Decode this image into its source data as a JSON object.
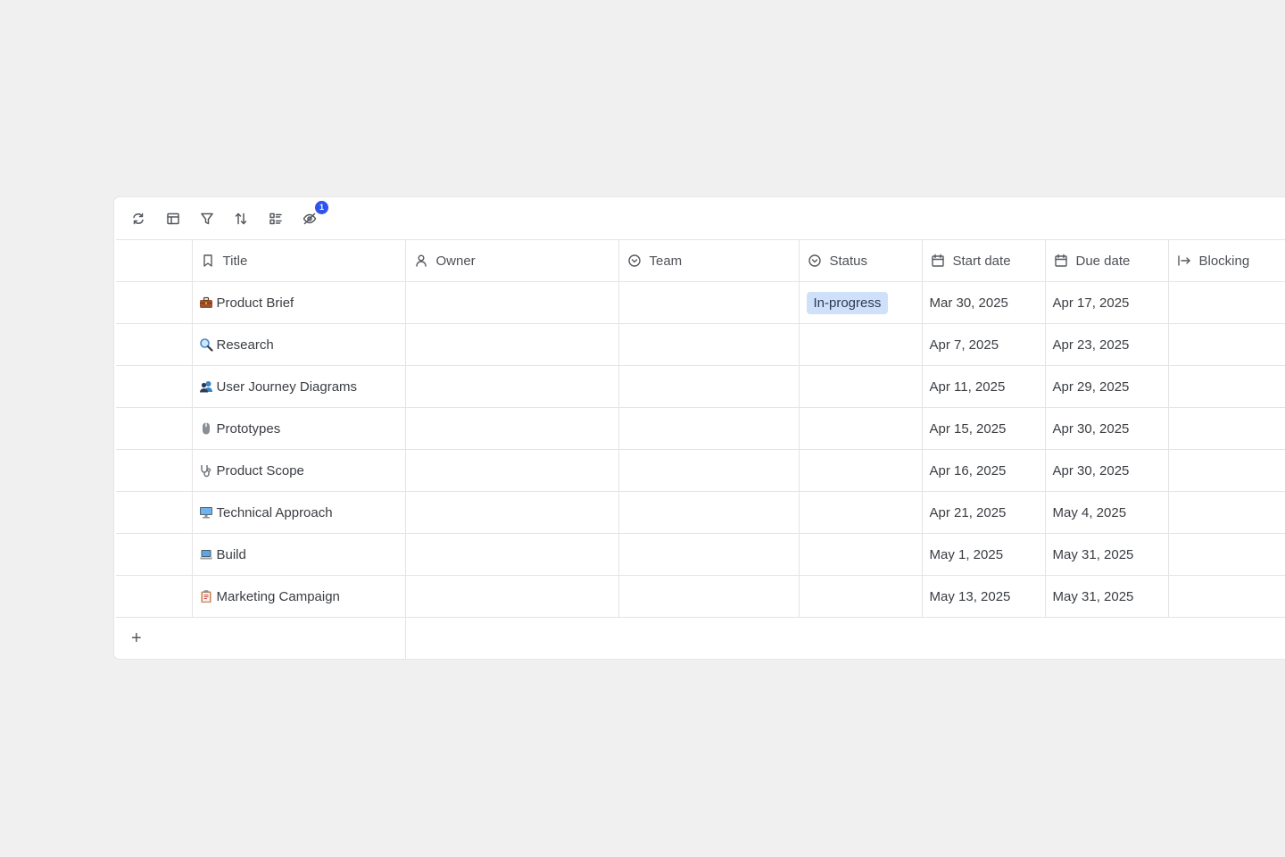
{
  "toolbar": {
    "hidden_fields_count": "1"
  },
  "columns": {
    "title": "Title",
    "owner": "Owner",
    "team": "Team",
    "status": "Status",
    "start": "Start date",
    "due": "Due date",
    "blocking": "Blocking"
  },
  "rows": [
    {
      "icon": "briefcase-icon",
      "title": "Product Brief",
      "status": "In-progress",
      "start": "Mar 30, 2025",
      "due": "Apr 17, 2025"
    },
    {
      "icon": "magnifier-icon",
      "title": "Research",
      "status": "",
      "start": "Apr 7, 2025",
      "due": "Apr 23, 2025"
    },
    {
      "icon": "people-icon",
      "title": "User Journey Diagrams",
      "status": "",
      "start": "Apr 11, 2025",
      "due": "Apr 29, 2025"
    },
    {
      "icon": "mouse-icon",
      "title": "Prototypes",
      "status": "",
      "start": "Apr 15, 2025",
      "due": "Apr 30, 2025"
    },
    {
      "icon": "stethoscope-icon",
      "title": "Product Scope",
      "status": "",
      "start": "Apr 16, 2025",
      "due": "Apr 30, 2025"
    },
    {
      "icon": "desktop-icon",
      "title": "Technical Approach",
      "status": "",
      "start": "Apr 21, 2025",
      "due": "May 4, 2025"
    },
    {
      "icon": "laptop-icon",
      "title": "Build",
      "status": "",
      "start": "May 1, 2025",
      "due": "May 31, 2025"
    },
    {
      "icon": "clipboard-icon",
      "title": "Marketing Campaign",
      "status": "",
      "start": "May 13, 2025",
      "due": "May 31, 2025"
    }
  ],
  "add_row_label": "+",
  "colors": {
    "status_bg": "#cfe0fb",
    "badge": "#2f54eb"
  }
}
